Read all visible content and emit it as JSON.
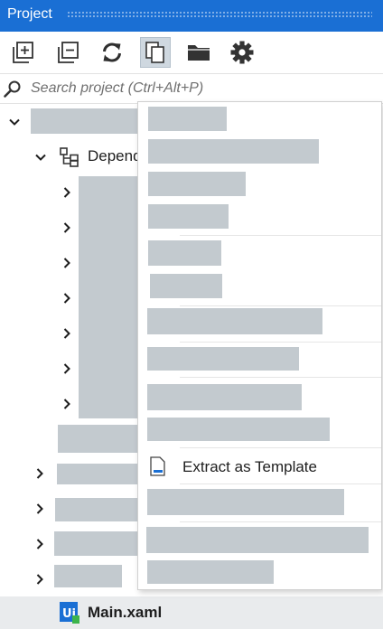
{
  "panel": {
    "title": "Project"
  },
  "toolbar": {
    "buttons": [
      {
        "icon": "expand-all-icon"
      },
      {
        "icon": "collapse-all-icon"
      },
      {
        "icon": "refresh-icon"
      },
      {
        "icon": "copy-icon",
        "active": true
      },
      {
        "icon": "folder-icon"
      },
      {
        "icon": "gear-icon"
      }
    ]
  },
  "search": {
    "placeholder": "Search project (Ctrl+Alt+P)"
  },
  "tree": {
    "dependencies_label": "Depend",
    "file_label": "Main.xaml",
    "file_icon_text": "Ui"
  },
  "context_menu": {
    "visible_item_label": "Extract as Template"
  },
  "colors": {
    "title_bar": "#1a6fd4",
    "redaction": "#c3cacf",
    "selected_row": "#e9ebed"
  }
}
